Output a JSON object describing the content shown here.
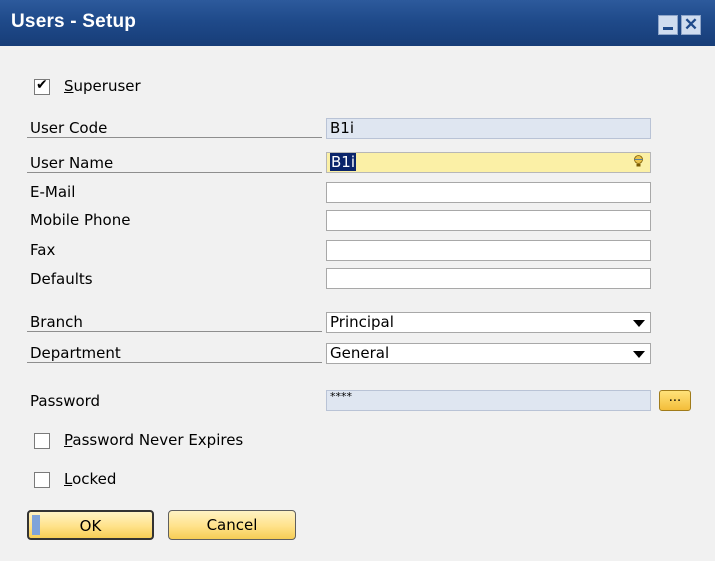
{
  "window": {
    "title": "Users - Setup",
    "close_glyph": "✕"
  },
  "superuser": {
    "label": "Superuser",
    "checked": true
  },
  "fields": {
    "user_code": {
      "label": "User Code",
      "value": "B1i"
    },
    "user_name": {
      "label": "User Name",
      "value": "B1i"
    },
    "email": {
      "label": "E-Mail",
      "value": ""
    },
    "mobile_phone": {
      "label": "Mobile Phone",
      "value": ""
    },
    "fax": {
      "label": "Fax",
      "value": ""
    },
    "defaults": {
      "label": "Defaults",
      "value": ""
    },
    "branch": {
      "label": "Branch",
      "value": "Principal"
    },
    "department": {
      "label": "Department",
      "value": "General"
    },
    "password": {
      "label": "Password",
      "value": "****",
      "button_label": "..."
    }
  },
  "options": {
    "password_never_expires": {
      "label": "Password Never Expires",
      "checked": false
    },
    "locked": {
      "label": "Locked",
      "checked": false
    }
  },
  "buttons": {
    "ok": "OK",
    "cancel": "Cancel"
  },
  "colors": {
    "titlebar": "#1f4a8a",
    "readonly_field": "#dfe6f1",
    "active_field": "#fbf0a6",
    "button": "#ffe28a"
  }
}
